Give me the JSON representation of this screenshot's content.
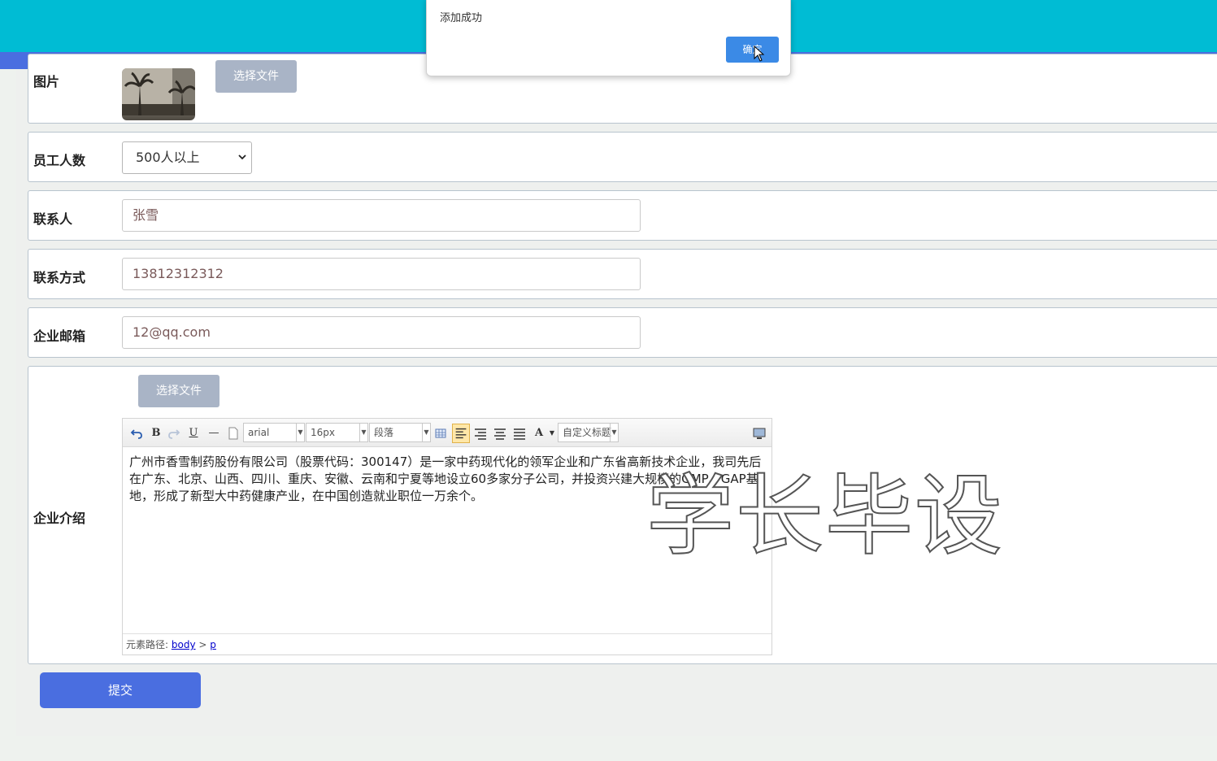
{
  "dialog": {
    "message": "添加成功",
    "ok_label": "确定"
  },
  "form": {
    "image": {
      "label": "图片",
      "file_button": "选择文件"
    },
    "employees": {
      "label": "员工人数",
      "selected": "500人以上"
    },
    "contact": {
      "label": "联系人",
      "value": "张雪"
    },
    "phone": {
      "label": "联系方式",
      "value": "13812312312"
    },
    "email": {
      "label": "企业邮箱",
      "value": "12@qq.com"
    },
    "intro": {
      "label": "企业介绍",
      "file_button": "选择文件",
      "font_family": "arial",
      "font_size": "16px",
      "paragraph": "段落",
      "custom_title": "自定义标题",
      "content": "广州市香雪制药股份有限公司（股票代码：300147）是一家中药现代化的领军企业和广东省高新技术企业，我司先后在广东、北京、山西、四川、重庆、安徽、云南和宁夏等地设立60多家分子公司，并投资兴建大规模的GMP、GAP基地，形成了新型大中药健康产业，在中国创造就业职位一万余个。",
      "path_label": "元素路径:",
      "path_body": "body",
      "path_sep": ">",
      "path_p": "p"
    },
    "submit_label": "提交"
  },
  "watermark": "学长毕设"
}
